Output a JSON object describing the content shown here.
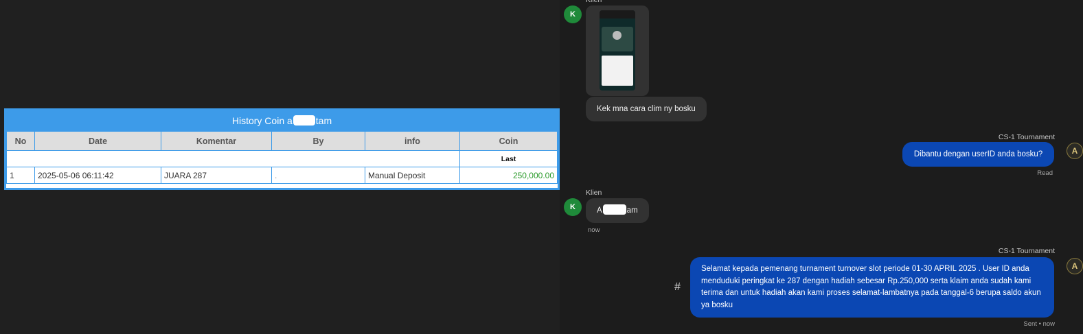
{
  "history": {
    "title_prefix": "History Coin a",
    "title_suffix": "tam",
    "columns": [
      "No",
      "Date",
      "Komentar",
      "By",
      "info",
      "Coin"
    ],
    "subheader": "Last",
    "rows": [
      {
        "no": "1",
        "date": "2025-05-06 06:11:42",
        "komentar": "JUARA 287",
        "by": ".",
        "info": "Manual Deposit",
        "coin": "250,000.00"
      }
    ]
  },
  "chat": {
    "client_name": "Klien",
    "client_initial": "K",
    "agent_name": "CS-1 Tournament",
    "agent_initial": "A",
    "msg1_text": "Kek mna cara clim ny bosku",
    "msg2_text": "Dibantu dengan userID anda bosku?",
    "msg2_status": "Read",
    "msg3_prefix": "A",
    "msg3_suffix": "am",
    "msg3_time": "now",
    "msg4_text": "Selamat kepada pemenang turnament turnover slot periode 01-30 APRIL 2025 . User ID anda menduduki peringkat ke 287 dengan hadiah sebesar Rp.250,000 serta klaim anda sudah kami terima dan untuk hadiah akan kami proses selamat-lambatnya pada tanggal-6 berupa saldo akun ya bosku",
    "msg4_status": "Sent • now",
    "hash_symbol": "#"
  },
  "colors": {
    "table_accent": "#3d9be9",
    "coin_green": "#2a9a2a",
    "agent_bubble": "#0b47b3",
    "client_avatar": "#1f8a3a"
  }
}
